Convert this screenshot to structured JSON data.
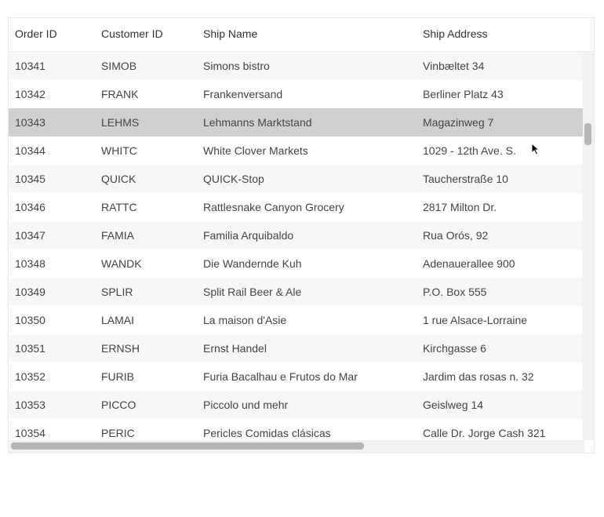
{
  "columns": {
    "orderid": "Order ID",
    "customerid": "Customer ID",
    "shipname": "Ship Name",
    "shipaddress": "Ship Address"
  },
  "rows": [
    {
      "orderid": "10341",
      "customerid": "SIMOB",
      "shipname": "Simons bistro",
      "shipaddress": "Vinbæltet 34",
      "alt": true,
      "selected": false
    },
    {
      "orderid": "10342",
      "customerid": "FRANK",
      "shipname": "Frankenversand",
      "shipaddress": "Berliner Platz 43",
      "alt": false,
      "selected": false
    },
    {
      "orderid": "10343",
      "customerid": "LEHMS",
      "shipname": "Lehmanns Marktstand",
      "shipaddress": "Magazinweg 7",
      "alt": true,
      "selected": true
    },
    {
      "orderid": "10344",
      "customerid": "WHITC",
      "shipname": "White Clover Markets",
      "shipaddress": "1029 - 12th Ave. S.",
      "alt": false,
      "selected": false
    },
    {
      "orderid": "10345",
      "customerid": "QUICK",
      "shipname": "QUICK-Stop",
      "shipaddress": "Taucherstraße 10",
      "alt": true,
      "selected": false
    },
    {
      "orderid": "10346",
      "customerid": "RATTC",
      "shipname": "Rattlesnake Canyon Grocery",
      "shipaddress": "2817 Milton Dr.",
      "alt": false,
      "selected": false
    },
    {
      "orderid": "10347",
      "customerid": "FAMIA",
      "shipname": "Familia Arquibaldo",
      "shipaddress": "Rua Orós, 92",
      "alt": true,
      "selected": false
    },
    {
      "orderid": "10348",
      "customerid": "WANDK",
      "shipname": "Die Wandernde Kuh",
      "shipaddress": "Adenauerallee 900",
      "alt": false,
      "selected": false
    },
    {
      "orderid": "10349",
      "customerid": "SPLIR",
      "shipname": "Split Rail Beer & Ale",
      "shipaddress": "P.O. Box 555",
      "alt": true,
      "selected": false
    },
    {
      "orderid": "10350",
      "customerid": "LAMAI",
      "shipname": "La maison d'Asie",
      "shipaddress": "1 rue Alsace-Lorraine",
      "alt": false,
      "selected": false
    },
    {
      "orderid": "10351",
      "customerid": "ERNSH",
      "shipname": "Ernst Handel",
      "shipaddress": "Kirchgasse 6",
      "alt": true,
      "selected": false
    },
    {
      "orderid": "10352",
      "customerid": "FURIB",
      "shipname": "Furia Bacalhau e Frutos do Mar",
      "shipaddress": "Jardim das rosas n. 32",
      "alt": false,
      "selected": false
    },
    {
      "orderid": "10353",
      "customerid": "PICCO",
      "shipname": "Piccolo und mehr",
      "shipaddress": "Geislweg 14",
      "alt": true,
      "selected": false
    },
    {
      "orderid": "10354",
      "customerid": "PERIC",
      "shipname": "Pericles Comidas clásicas",
      "shipaddress": "Calle Dr. Jorge Cash 321",
      "alt": false,
      "selected": false
    }
  ]
}
